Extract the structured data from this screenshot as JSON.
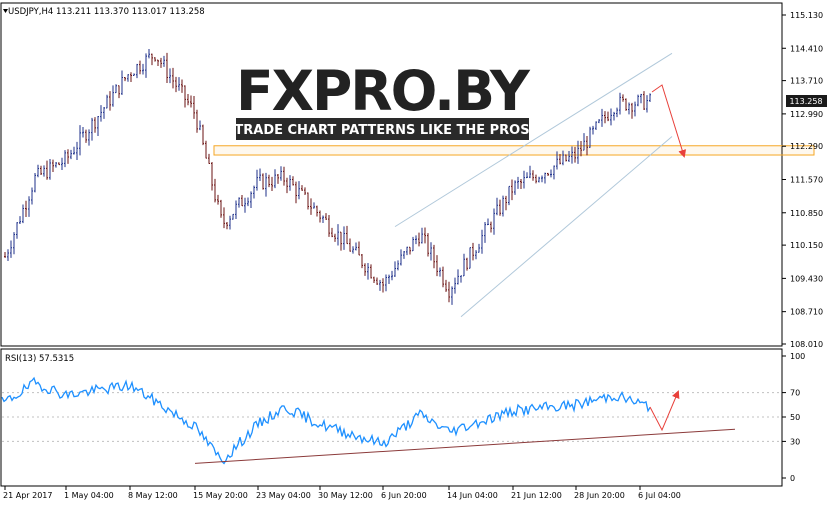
{
  "window": {
    "header_text": "USDJPY,H4  113.211 113.370 113.017 113.258",
    "current_price": "113.258"
  },
  "price_axis": {
    "labels": [
      "115.130",
      "114.410",
      "113.710",
      "112.990",
      "112.290",
      "111.570",
      "110.850",
      "110.150",
      "109.430",
      "108.710",
      "108.010"
    ],
    "range": [
      108.01,
      115.13
    ]
  },
  "rsi_panel": {
    "title": "RSI(13) 57.5315",
    "labels": [
      "100",
      "70",
      "50",
      "30",
      "0"
    ],
    "levels": [
      70,
      50,
      30
    ]
  },
  "time_axis": {
    "labels": [
      "21 Apr 2017",
      "1 May 04:00",
      "8 May 12:00",
      "15 May 20:00",
      "23 May 04:00",
      "30 May 12:00",
      "6 Jun 20:00",
      "14 Jun 04:00",
      "21 Jun 12:00",
      "28 Jun 20:00",
      "6 Jul 04:00"
    ]
  },
  "watermark": {
    "brand": "FXPRO.BY",
    "tagline": "TRADE CHART PATTERNS LIKE THE PROS"
  },
  "colors": {
    "bull": "#1d2f8a",
    "bear": "#6a1010",
    "rsi": "#1e90ff",
    "channel": "#b0c8da",
    "zone": "#f5a623",
    "arrow": "#e8403a",
    "trendline": "#8b3a3a",
    "price_tag_bg": "#1a1a1a"
  },
  "chart_data": {
    "type": "candlestick",
    "x_range": [
      "21 Apr 2017",
      "6 Jul 04:00"
    ],
    "price_anchors": [
      {
        "t": "21 Apr 2017",
        "price": 109.9
      },
      {
        "t": "26 Apr 2017",
        "price": 111.6
      },
      {
        "t": "1 May 04:00",
        "price": 112.0
      },
      {
        "t": "8 May 12:00",
        "price": 113.9
      },
      {
        "t": "11 May 2017",
        "price": 114.3
      },
      {
        "t": "15 May 20:00",
        "price": 113.0
      },
      {
        "t": "17 May 2017",
        "price": 110.6
      },
      {
        "t": "23 May 04:00",
        "price": 111.5
      },
      {
        "t": "26 May 2017",
        "price": 111.6
      },
      {
        "t": "30 May 12:00",
        "price": 110.8
      },
      {
        "t": "6 Jun 20:00",
        "price": 109.3
      },
      {
        "t": "9 Jun 2017",
        "price": 110.4
      },
      {
        "t": "14 Jun 04:00",
        "price": 109.2
      },
      {
        "t": "21 Jun 12:00",
        "price": 111.4
      },
      {
        "t": "28 Jun 20:00",
        "price": 112.1
      },
      {
        "t": "3 Jul 2017",
        "price": 113.2
      },
      {
        "t": "6 Jul 04:00",
        "price": 113.26
      }
    ],
    "rsi_anchors": [
      {
        "t": "21 Apr 2017",
        "rsi": 62
      },
      {
        "t": "26 Apr 2017",
        "rsi": 78
      },
      {
        "t": "1 May 04:00",
        "rsi": 68
      },
      {
        "t": "8 May 12:00",
        "rsi": 76
      },
      {
        "t": "11 May 2017",
        "rsi": 63
      },
      {
        "t": "15 May 20:00",
        "rsi": 42
      },
      {
        "t": "17 May 2017",
        "rsi": 14
      },
      {
        "t": "23 May 04:00",
        "rsi": 44
      },
      {
        "t": "26 May 2017",
        "rsi": 58
      },
      {
        "t": "30 May 12:00",
        "rsi": 44
      },
      {
        "t": "6 Jun 20:00",
        "rsi": 28
      },
      {
        "t": "9 Jun 2017",
        "rsi": 52
      },
      {
        "t": "14 Jun 04:00",
        "rsi": 38
      },
      {
        "t": "21 Jun 12:00",
        "rsi": 55
      },
      {
        "t": "28 Jun 20:00",
        "rsi": 60
      },
      {
        "t": "3 Jul 2017",
        "rsi": 68
      },
      {
        "t": "6 Jul 04:00",
        "rsi": 57.5
      }
    ],
    "annotations": {
      "channel_upper": [
        {
          "t": "6 Jun 20:00",
          "price": 110.55
        },
        {
          "t": "6 Jul 04:00",
          "price": 114.3
        }
      ],
      "channel_lower": [
        {
          "t": "14 Jun 04:00",
          "price": 108.6
        },
        {
          "t": "6 Jul 04:00",
          "price": 112.5
        }
      ],
      "resistance_zone": [
        112.1,
        112.3
      ],
      "rsi_trendline": [
        {
          "t": "15 May 20:00",
          "rsi": 12
        },
        {
          "t": "6 Jul 04:00",
          "rsi": 40
        }
      ]
    }
  }
}
